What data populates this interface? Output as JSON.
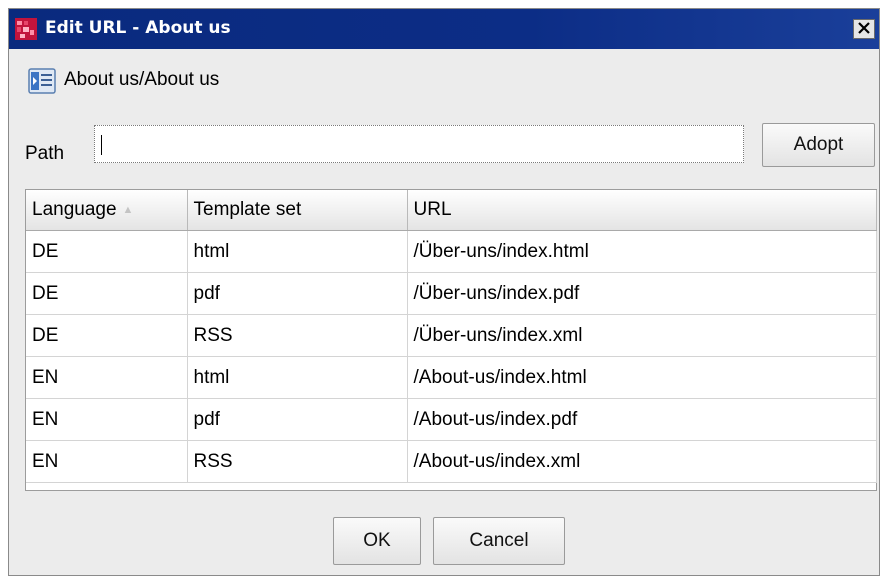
{
  "window": {
    "title": "Edit URL - About us",
    "close_glyph": "X"
  },
  "document": {
    "path": "About us/About us",
    "icon": "page-properties-icon"
  },
  "path_field": {
    "label": "Path",
    "value": ""
  },
  "buttons": {
    "adopt": "Adopt",
    "ok": "OK",
    "cancel": "Cancel"
  },
  "table": {
    "columns": [
      "Language",
      "Template set",
      "URL"
    ],
    "sort_indicator": "▲",
    "rows": [
      [
        "DE",
        "html",
        "/Über-uns/index.html"
      ],
      [
        "DE",
        "pdf",
        "/Über-uns/index.pdf"
      ],
      [
        "DE",
        "RSS",
        "/Über-uns/index.xml"
      ],
      [
        "EN",
        "html",
        "/About-us/index.html"
      ],
      [
        "EN",
        "pdf",
        "/About-us/index.pdf"
      ],
      [
        "EN",
        "RSS",
        "/About-us/index.xml"
      ]
    ]
  },
  "colors": {
    "titlebar": "#0c2d86",
    "dialog_bg": "#ececec"
  }
}
